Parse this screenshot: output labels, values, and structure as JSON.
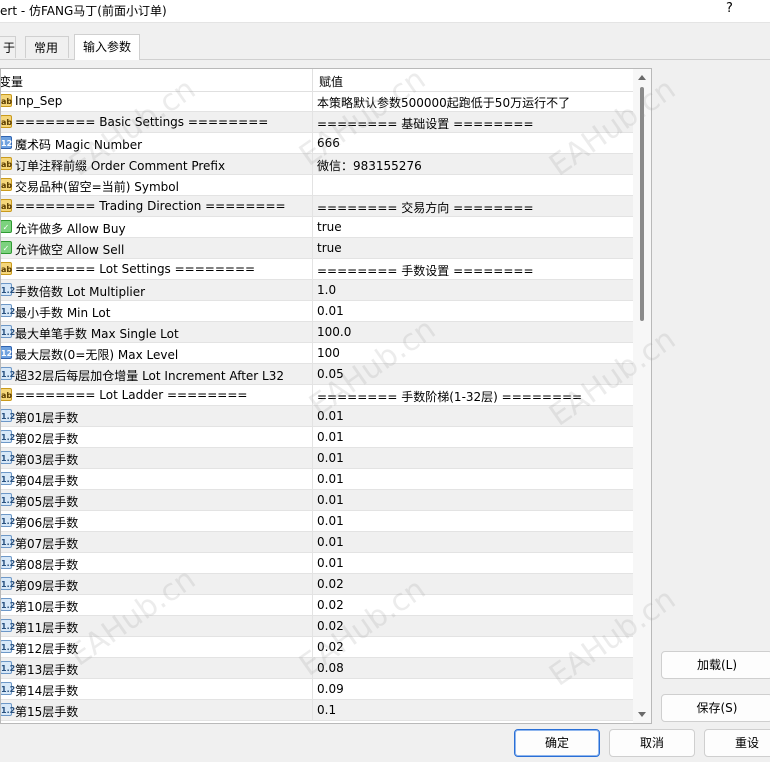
{
  "window": {
    "title": "ert - 仿FANG马丁(前面小订单)",
    "help_label": "?"
  },
  "tabs": [
    {
      "label": "于"
    },
    {
      "label": "常用"
    },
    {
      "label": "输入参数"
    }
  ],
  "grid": {
    "col_variable": "变量",
    "col_value": "赋值",
    "rows": [
      {
        "icon": "ab",
        "name": "Inp_Sep",
        "value": "本策略默认参数500000起跑低于50万运行不了"
      },
      {
        "icon": "ab",
        "name": "======== Basic Settings ========",
        "value": "======== 基础设置 ========"
      },
      {
        "icon": "num",
        "name": "魔术码 Magic Number",
        "value": "666"
      },
      {
        "icon": "ab",
        "name": "订单注释前缀 Order Comment Prefix",
        "value": "微信：983155276"
      },
      {
        "icon": "ab",
        "name": "交易品种(留空=当前) Symbol",
        "value": ""
      },
      {
        "icon": "ab",
        "name": "======== Trading Direction ========",
        "value": "======== 交易方向 ========"
      },
      {
        "icon": "bool",
        "name": "允许做多 Allow Buy",
        "value": "true"
      },
      {
        "icon": "bool",
        "name": "允许做空 Allow Sell",
        "value": "true"
      },
      {
        "icon": "ab",
        "name": "======== Lot Settings ========",
        "value": "======== 手数设置 ========"
      },
      {
        "icon": "dbl",
        "name": "手数倍数 Lot Multiplier",
        "value": "1.0"
      },
      {
        "icon": "dbl",
        "name": "最小手数 Min Lot",
        "value": "0.01"
      },
      {
        "icon": "dbl",
        "name": "最大单笔手数 Max Single Lot",
        "value": "100.0"
      },
      {
        "icon": "num",
        "name": "最大层数(0=无限) Max Level",
        "value": "100"
      },
      {
        "icon": "dbl",
        "name": "超32层后每层加仓增量 Lot Increment After L32",
        "value": "0.05"
      },
      {
        "icon": "ab",
        "name": "======== Lot Ladder ========",
        "value": "======== 手数阶梯(1-32层) ========"
      },
      {
        "icon": "dbl",
        "name": "第01层手数",
        "value": "0.01"
      },
      {
        "icon": "dbl",
        "name": "第02层手数",
        "value": "0.01"
      },
      {
        "icon": "dbl",
        "name": "第03层手数",
        "value": "0.01"
      },
      {
        "icon": "dbl",
        "name": "第04层手数",
        "value": "0.01"
      },
      {
        "icon": "dbl",
        "name": "第05层手数",
        "value": "0.01"
      },
      {
        "icon": "dbl",
        "name": "第06层手数",
        "value": "0.01"
      },
      {
        "icon": "dbl",
        "name": "第07层手数",
        "value": "0.01"
      },
      {
        "icon": "dbl",
        "name": "第08层手数",
        "value": "0.01"
      },
      {
        "icon": "dbl",
        "name": "第09层手数",
        "value": "0.02"
      },
      {
        "icon": "dbl",
        "name": "第10层手数",
        "value": "0.02"
      },
      {
        "icon": "dbl",
        "name": "第11层手数",
        "value": "0.02"
      },
      {
        "icon": "dbl",
        "name": "第12层手数",
        "value": "0.02"
      },
      {
        "icon": "dbl",
        "name": "第13层手数",
        "value": "0.08"
      },
      {
        "icon": "dbl",
        "name": "第14层手数",
        "value": "0.09"
      },
      {
        "icon": "dbl",
        "name": "第15层手数",
        "value": "0.1"
      }
    ]
  },
  "side_buttons": {
    "load_label": "加载(L)",
    "save_label": "保存(S)"
  },
  "footer_buttons": {
    "ok_label": "确定",
    "cancel_label": "取消",
    "reset_label": "重设"
  },
  "watermark_text": "EAHub.cn",
  "icon_glyphs": {
    "ab": "ab",
    "num": "123",
    "bool": "✓",
    "dbl": "1.2"
  }
}
